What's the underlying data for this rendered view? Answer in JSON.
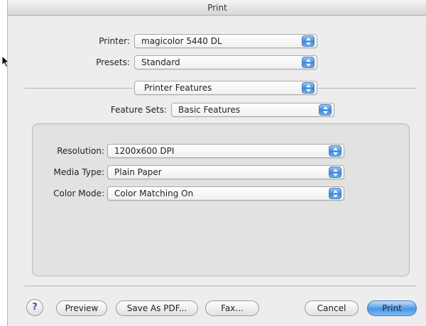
{
  "window": {
    "title": "Print"
  },
  "printer": {
    "label": "Printer:",
    "value": "magicolor 5440 DL"
  },
  "presets": {
    "label": "Presets:",
    "value": "Standard"
  },
  "pane": {
    "value": "Printer Features"
  },
  "feature_sets": {
    "label": "Feature Sets:",
    "value": "Basic Features"
  },
  "options": [
    {
      "label": "Resolution:",
      "value": "1200x600 DPI"
    },
    {
      "label": "Media Type:",
      "value": "Plain Paper"
    },
    {
      "label": "Color Mode:",
      "value": "Color Matching On"
    }
  ],
  "buttons": {
    "help": "?",
    "preview": "Preview",
    "save_pdf": "Save As PDF...",
    "fax": "Fax...",
    "cancel": "Cancel",
    "print": "Print"
  },
  "colors": {
    "accent": "#3c86d8",
    "window_bg": "#ededed",
    "panel_bg": "#e2e2e2"
  },
  "icons": {
    "popup_arrows": "updown-arrows-icon",
    "cursor": "mouse-pointer-icon",
    "help": "question-mark-icon"
  }
}
